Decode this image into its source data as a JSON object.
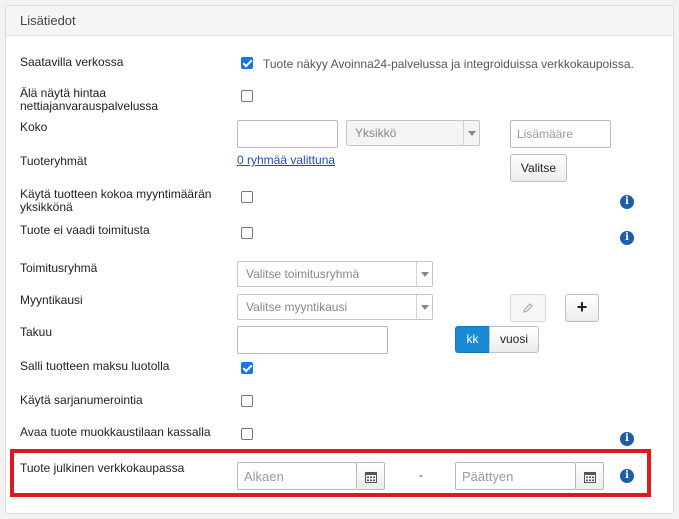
{
  "panel": {
    "title": "Lisätiedot"
  },
  "rows": {
    "saatavilla": {
      "label": "Saatavilla verkossa",
      "checked": true,
      "note": "Tuote näkyy Avoinna24-palvelussa ja integroiduissa verkkokaupoissa."
    },
    "ala_nayta": {
      "label_line1": "Älä näytä hintaa",
      "label_line2": "nettiajanvarauspalvelussa",
      "checked": false
    },
    "koko": {
      "label": "Koko",
      "value": "",
      "unit_placeholder": "Yksikkö",
      "extra_placeholder": "Lisämääre"
    },
    "tuoteryhmat": {
      "label": "Tuoteryhmät",
      "link": "0 ryhmää valittuna",
      "select_button": "Valitse"
    },
    "kayta_kokoa": {
      "label_line1": "Käytä tuotteen kokoa myyntimäärän",
      "label_line2": "yksikkönä",
      "checked": false
    },
    "ei_toimitusta": {
      "label": "Tuote ei vaadi toimitusta",
      "checked": false
    },
    "toimitusryhma": {
      "label": "Toimitusryhmä",
      "placeholder": "Valitse toimitusryhmä"
    },
    "myyntikausi": {
      "label": "Myyntikausi",
      "placeholder": "Valitse myyntikausi",
      "add_button": "+"
    },
    "takuu": {
      "label": "Takuu",
      "value": "",
      "unit_kk": "kk",
      "unit_vuosi": "vuosi"
    },
    "luotolla": {
      "label": "Salli tuotteen maksu luotolla",
      "checked": true
    },
    "sarjanumerointi": {
      "label": "Käytä sarjanumerointia",
      "checked": false
    },
    "muokkaustila": {
      "label": "Avaa tuote muokkaustilaan kassalla",
      "checked": false
    },
    "julkinen": {
      "label": "Tuote julkinen verkkokaupassa",
      "start_placeholder": "Alkaen",
      "separator": "-",
      "end_placeholder": "Päättyen"
    }
  },
  "icons": {
    "info": "i",
    "calendar": "calendar-icon",
    "pencil": "pencil-icon"
  },
  "colors": {
    "accent": "#1a8ad4",
    "info": "#1d5ea8",
    "highlight": "#e01822",
    "link": "#1a4fb8"
  }
}
